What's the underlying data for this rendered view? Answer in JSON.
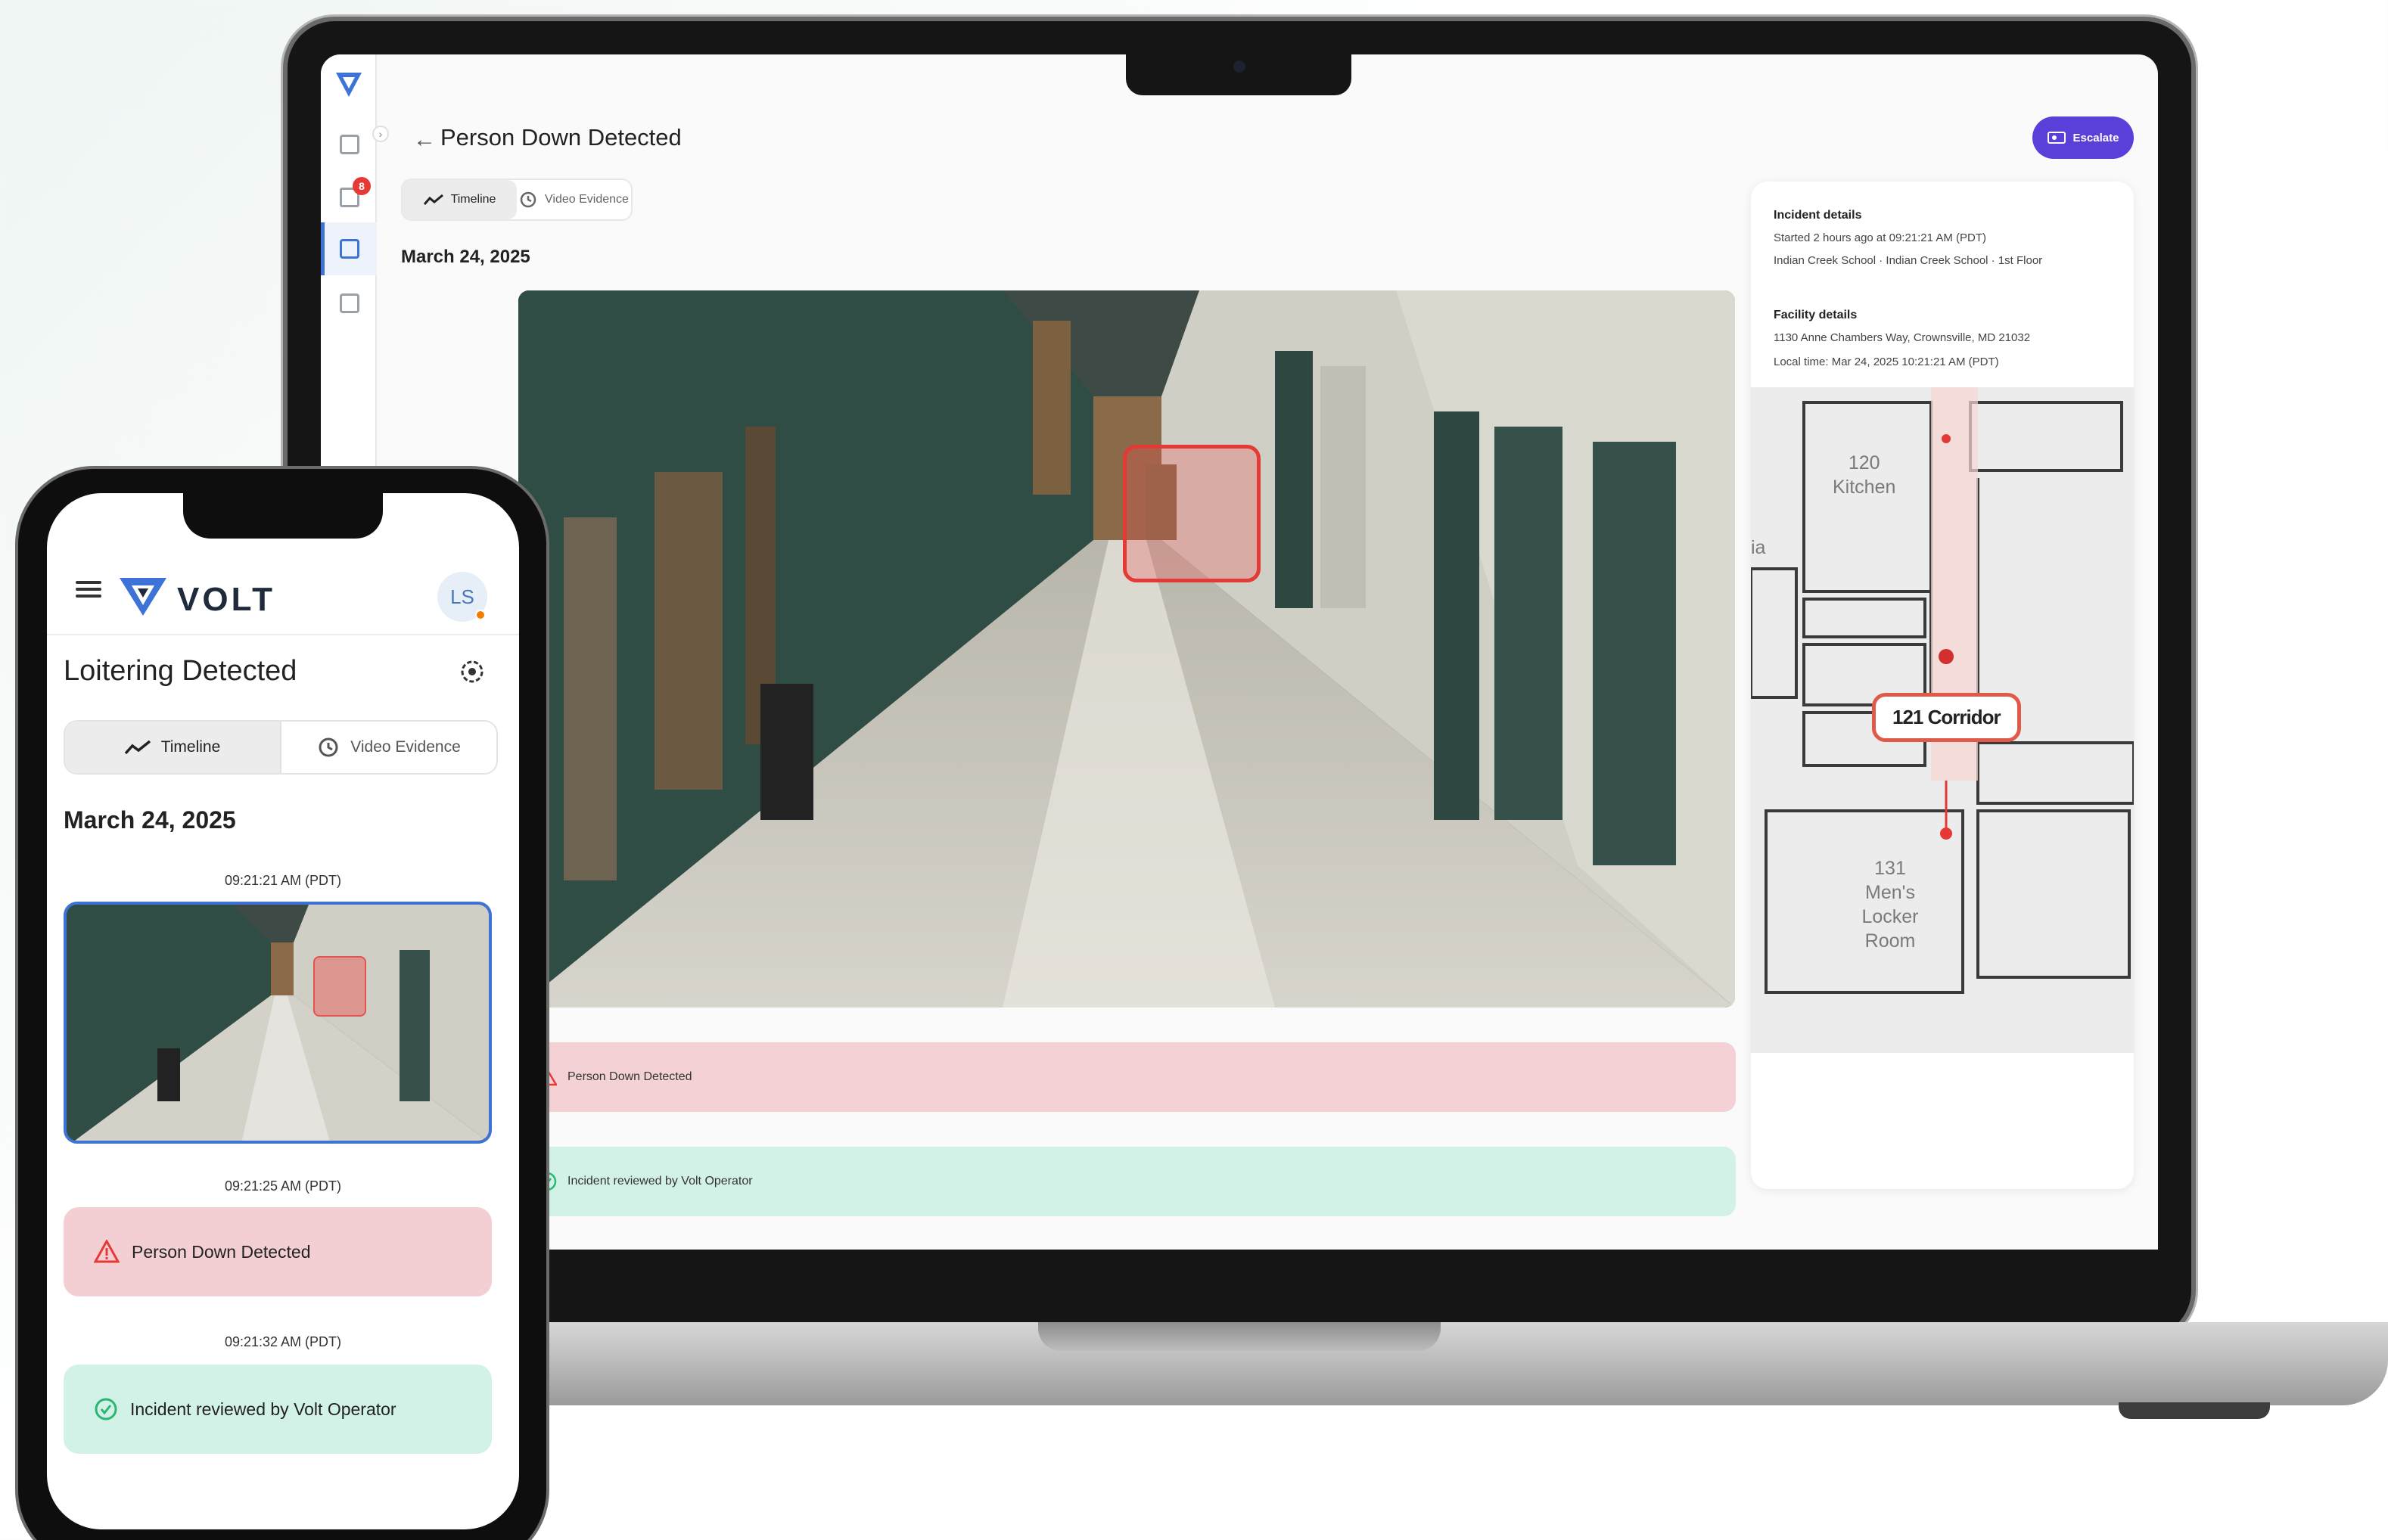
{
  "laptop": {
    "sidebar": {
      "notification_count": "8",
      "items": [
        {
          "icon": "dashboard-icon"
        },
        {
          "icon": "monitor-icon"
        },
        {
          "icon": "document-icon"
        },
        {
          "icon": "building-icon"
        }
      ]
    },
    "header": {
      "back_icon": "arrow-left-icon",
      "title": "Person Down Detected",
      "escalate_label": "Escalate"
    },
    "tabs": [
      {
        "label": "Timeline",
        "icon": "trend-line-icon",
        "active": true
      },
      {
        "label": "Video Evidence",
        "icon": "history-icon",
        "active": false
      }
    ],
    "date": "March 24, 2025",
    "events": [
      {
        "label": "Person Down Detected",
        "icon": "warning-icon",
        "color": "#f3d1d5"
      },
      {
        "label": "Incident reviewed by Volt Operator",
        "icon": "check-circle-icon",
        "color": "#d3f2e7"
      }
    ],
    "incident_details": {
      "heading": "Incident details",
      "started": "Started 2 hours ago at 09:21:21 AM (PDT)",
      "location": "Indian Creek School · Indian Creek School · 1st Floor"
    },
    "facility_details": {
      "heading": "Facility details",
      "address": "1130 Anne Chambers Way, Crownsville, MD 21032",
      "local_time": "Local time: Mar 24, 2025 10:21:21 AM (PDT)"
    },
    "map": {
      "label": "121 Corridor",
      "room_kitchen": "120\nKitchen",
      "room_locker": "131\nMen's\nLocker\nRoom",
      "partial_label": "ia"
    }
  },
  "phone": {
    "brand": "VOLT",
    "avatar_initials": "LS",
    "title": "Loitering Detected",
    "tabs": [
      {
        "label": "Timeline",
        "icon": "trend-line-icon",
        "active": true
      },
      {
        "label": "Video Evidence",
        "icon": "history-icon",
        "active": false
      }
    ],
    "date": "March 24, 2025",
    "timeline": [
      {
        "time": "09:21:21 AM (PDT)",
        "type": "video"
      },
      {
        "time": "09:21:25 AM (PDT)",
        "type": "alert",
        "label": "Person Down Detected"
      },
      {
        "time": "09:21:32 AM (PDT)",
        "type": "review",
        "label": "Incident reviewed by Volt Operator"
      }
    ]
  },
  "colors": {
    "accent": "#5b3fd9",
    "brand_blue": "#3d72d6",
    "alert_bg": "#f3d1d5",
    "success_bg": "#d3f2e7",
    "alert_red": "#e53935",
    "success_green": "#2bb673"
  }
}
